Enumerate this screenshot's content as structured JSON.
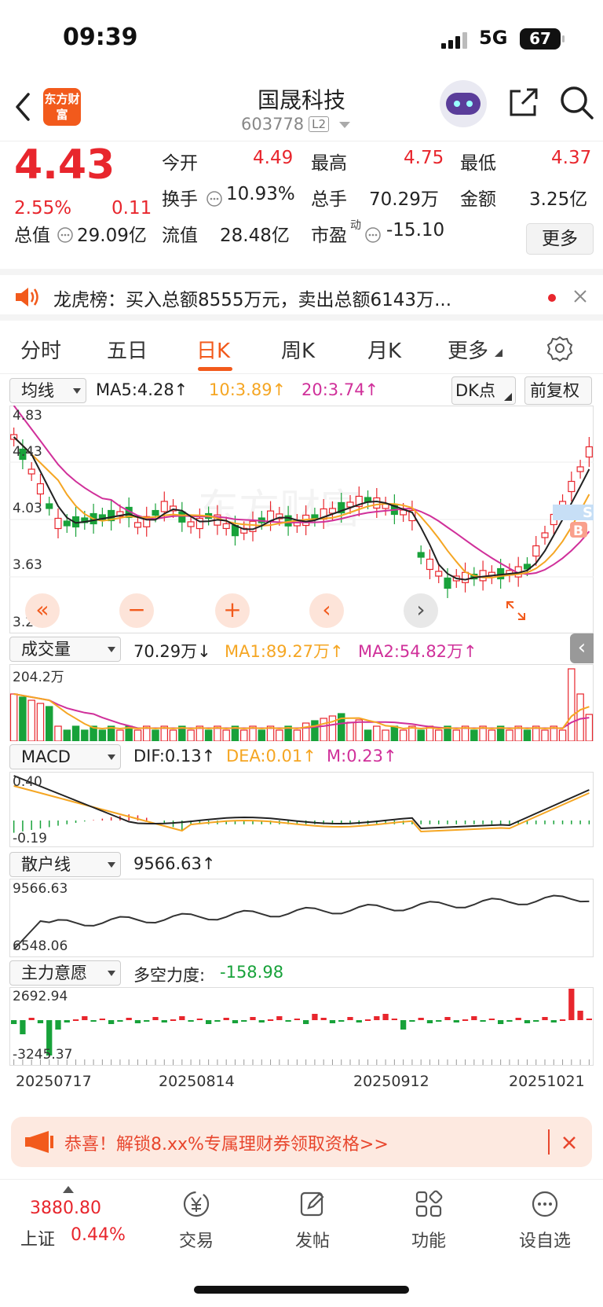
{
  "status_bar": {
    "time": "09:39",
    "network": "5G",
    "battery": "67"
  },
  "header": {
    "title": "国晟科技",
    "code": "603778",
    "level_badge": "L2",
    "logo_text": "东方财富"
  },
  "quote": {
    "price": "4.43",
    "change_pct": "2.55%",
    "change_abs": "0.11",
    "open_label": "今开",
    "open": "4.49",
    "high_label": "最高",
    "high": "4.75",
    "low_label": "最低",
    "low": "4.37",
    "turnover_label": "换手",
    "turnover": "10.93%",
    "volume_label": "总手",
    "volume": "70.29万",
    "amount_label": "金额",
    "amount": "3.25亿",
    "mktcap_label": "总值",
    "mktcap": "29.09亿",
    "float_label": "流值",
    "float_cap": "28.48亿",
    "pe_label": "市盈",
    "pe_sup": "动",
    "pe": "-15.10",
    "more_button": "更多"
  },
  "notice": {
    "text": "龙虎榜：买入总额8555万元，卖出总额6143万..."
  },
  "tabs": [
    "分时",
    "五日",
    "日K",
    "周K",
    "月K",
    "更多"
  ],
  "active_tab": "日K",
  "kline": {
    "indicator_select": "均线",
    "ma5": "MA5:4.28↑",
    "ma10": "10:3.89↑",
    "ma20": "20:3.74↑",
    "dk_button": "DK点",
    "adjust_button": "前复权",
    "y_ticks": [
      "4.83",
      "4.43",
      "4.03",
      "3.63",
      "3.23"
    ],
    "marker_s": "S",
    "marker_b": "B",
    "watermark": "东方财富"
  },
  "volume": {
    "select": "成交量",
    "value": "70.29万↓",
    "ma1": "MA1:89.27万↑",
    "ma2": "MA2:54.82万↑",
    "y_top": "204.2万"
  },
  "macd": {
    "select": "MACD",
    "dif": "DIF:0.13↑",
    "dea": "DEA:0.01↑",
    "m": "M:0.23↑",
    "y_top": "0.40",
    "y_bottom": "-0.19"
  },
  "retail": {
    "select": "散户线",
    "value": "9566.63↑",
    "y_top": "9566.63",
    "y_bottom": "6548.06"
  },
  "main_force": {
    "select": "主力意愿",
    "label": "多空力度:",
    "value": "-158.98",
    "y_top": "2692.94",
    "y_bottom": "-3245.37"
  },
  "x_dates": [
    "20250717",
    "20250814",
    "20250912",
    "20251021"
  ],
  "promo": {
    "text": "恭喜！解锁8.xx%专属理财券领取资格>>"
  },
  "bottom_bar": {
    "index_value": "3880.80",
    "index_name": "上证",
    "index_change": "0.44%",
    "items": [
      "交易",
      "发帖",
      "功能",
      "设自选"
    ]
  },
  "colors": {
    "up": "#e8262d",
    "down": "#18a23a",
    "accent": "#f25a1c",
    "ma10": "#f5a623",
    "ma20": "#d0309a"
  }
}
